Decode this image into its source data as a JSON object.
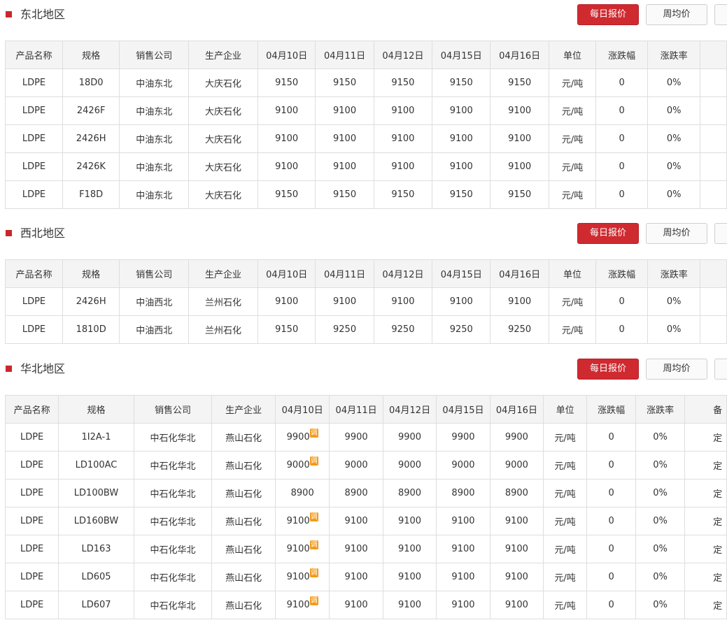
{
  "buttons": {
    "daily": "每日报价",
    "weekly": "周均价"
  },
  "badge_text": "调",
  "colors": {
    "accent": "#cf2a30",
    "link": "#2463c4",
    "up": "#e02a2a",
    "badge": "#f29a1c"
  },
  "headers": [
    "产品名称",
    "规格",
    "销售公司",
    "生产企业",
    "04月10日",
    "04月11日",
    "04月12日",
    "04月15日",
    "04月16日",
    "单位",
    "涨跌幅",
    "涨跌率",
    "备"
  ],
  "sections": [
    {
      "title": "东北地区",
      "rows": [
        {
          "product": "LDPE",
          "spec": "18D0",
          "seller": "中油东北",
          "producer": "大庆石化",
          "p1": "9150",
          "p2": "9150",
          "p3": "9150",
          "p4": "9150",
          "p5": "9150",
          "unit": "元/吨",
          "change": "0",
          "rate": "0%"
        },
        {
          "product": "LDPE",
          "spec": "2426F",
          "seller": "中油东北",
          "producer": "大庆石化",
          "p1": "9100",
          "p2": "9100",
          "p3": "9100",
          "p4": "9100",
          "p5": "9100",
          "unit": "元/吨",
          "change": "0",
          "rate": "0%"
        },
        {
          "product": "LDPE",
          "spec": "2426H",
          "seller": "中油东北",
          "producer": "大庆石化",
          "p1": "9100",
          "p2": "9100",
          "p3": "9100",
          "p4": "9100",
          "p5": "9100",
          "unit": "元/吨",
          "change": "0",
          "rate": "0%"
        },
        {
          "product": "LDPE",
          "spec": "2426K",
          "seller": "中油东北",
          "producer": "大庆石化",
          "p1": "9100",
          "p2": "9100",
          "p3": "9100",
          "p4": "9100",
          "p5": "9100",
          "unit": "元/吨",
          "change": "0",
          "rate": "0%"
        },
        {
          "product": "LDPE",
          "spec": "F18D",
          "seller": "中油东北",
          "producer": "大庆石化",
          "p1": "9150",
          "p2": "9150",
          "p3": "9150",
          "p4": "9150",
          "p5": "9150",
          "unit": "元/吨",
          "change": "0",
          "rate": "0%"
        }
      ]
    },
    {
      "title": "西北地区",
      "rows": [
        {
          "product": "LDPE",
          "spec": "2426H",
          "seller": "中油西北",
          "producer": "兰州石化",
          "p1": "9100",
          "p2": "9100",
          "p3": "9100",
          "p4": "9100",
          "p5": "9100",
          "unit": "元/吨",
          "change": "0",
          "rate": "0%"
        },
        {
          "product": "LDPE",
          "spec": "1810D",
          "seller": "中油西北",
          "producer": "兰州石化",
          "p1": "9150",
          "p2": "9250",
          "p3": "9250",
          "p4": "9250",
          "p5": "9250",
          "unit": "元/吨",
          "change": "0",
          "rate": "0%"
        }
      ]
    },
    {
      "title": "华北地区",
      "rows": [
        {
          "product": "LDPE",
          "spec": "1I2A-1",
          "seller": "中石化华北",
          "producer": "燕山石化",
          "p1": "9900",
          "p2": "9900",
          "p3": "9900",
          "p4": "9900",
          "p5": "9900",
          "unit": "元/吨",
          "change": "0",
          "rate": "0%",
          "note": "定"
        },
        {
          "product": "LDPE",
          "spec": "LD100AC",
          "seller": "中石化华北",
          "producer": "燕山石化",
          "p1": "9000",
          "p2": "9000",
          "p3": "9000",
          "p4": "9000",
          "p5": "9000",
          "unit": "元/吨",
          "change": "0",
          "rate": "0%",
          "note": "定"
        },
        {
          "product": "LDPE",
          "spec": "LD100BW",
          "seller": "中石化华北",
          "producer": "燕山石化",
          "p1": "8900",
          "p2": "8900",
          "p3": "8900",
          "p4": "8900",
          "p5": "8900",
          "unit": "元/吨",
          "change": "0",
          "rate": "0%",
          "note": "定"
        },
        {
          "product": "LDPE",
          "spec": "LD160BW",
          "seller": "中石化华北",
          "producer": "燕山石化",
          "p1": "9100",
          "p2": "9100",
          "p3": "9100",
          "p4": "9100",
          "p5": "9100",
          "unit": "元/吨",
          "change": "0",
          "rate": "0%",
          "note": "定"
        },
        {
          "product": "LDPE",
          "spec": "LD163",
          "seller": "中石化华北",
          "producer": "燕山石化",
          "p1": "9100",
          "p2": "9100",
          "p3": "9100",
          "p4": "9100",
          "p5": "9100",
          "unit": "元/吨",
          "change": "0",
          "rate": "0%",
          "note": "定"
        },
        {
          "product": "LDPE",
          "spec": "LD605",
          "seller": "中石化华北",
          "producer": "燕山石化",
          "p1": "9100",
          "p2": "9100",
          "p3": "9100",
          "p4": "9100",
          "p5": "9100",
          "unit": "元/吨",
          "change": "0",
          "rate": "0%",
          "note": "定"
        },
        {
          "product": "LDPE",
          "spec": "LD607",
          "seller": "中石化华北",
          "producer": "燕山石化",
          "p1": "9100",
          "p2": "9100",
          "p3": "9100",
          "p4": "9100",
          "p5": "9100",
          "unit": "元/吨",
          "change": "0",
          "rate": "0%",
          "note": "定"
        }
      ]
    }
  ]
}
